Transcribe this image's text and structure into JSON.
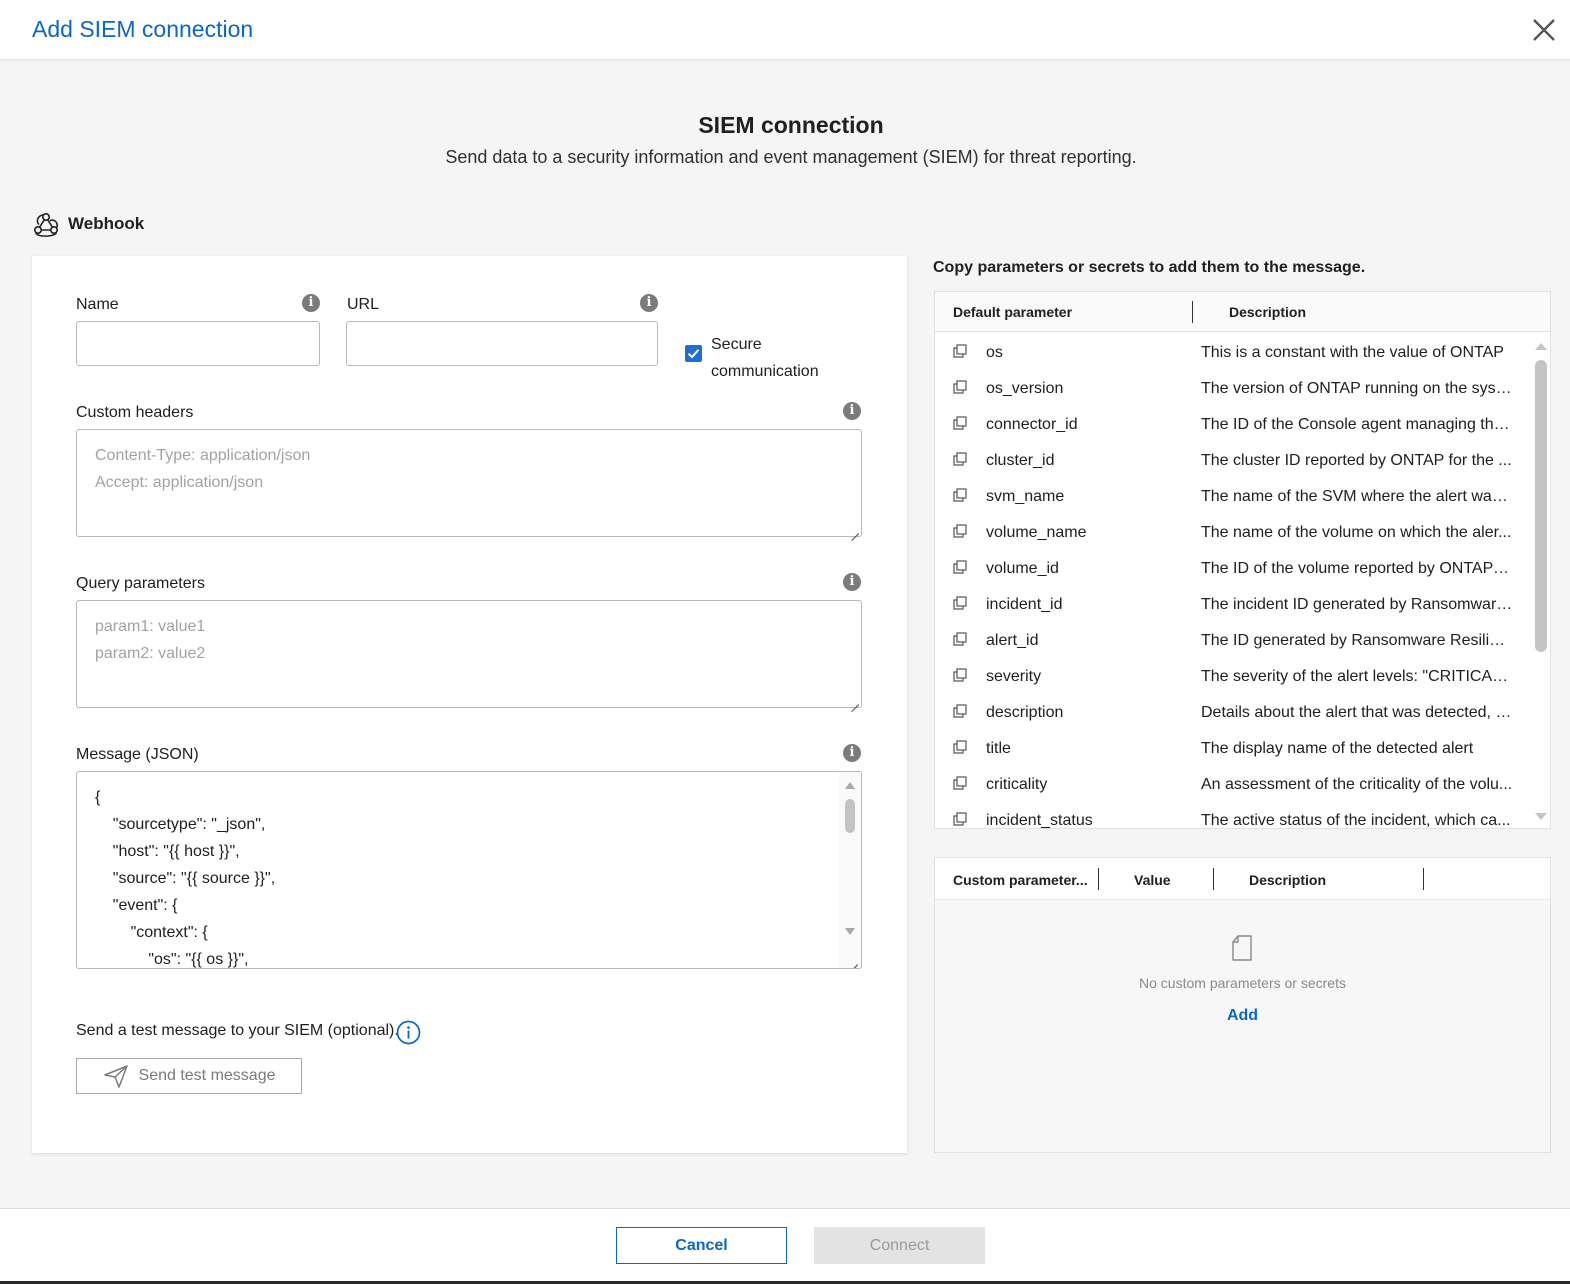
{
  "window": {
    "title": "Add SIEM connection"
  },
  "header": {
    "title": "SIEM connection",
    "subtitle": "Send data to a security information and event management (SIEM) for threat reporting."
  },
  "section": {
    "label": "Webhook",
    "icon": "webhook-icon"
  },
  "form": {
    "name_label": "Name",
    "name_value": "",
    "url_label": "URL",
    "url_value": "",
    "secure_label": "Secure communication",
    "secure_checked": true,
    "custom_headers_label": "Custom headers",
    "custom_headers_placeholder": "Content-Type: application/json\nAccept: application/json",
    "query_params_label": "Query parameters",
    "query_params_placeholder": "param1: value1\nparam2: value2",
    "message_label": "Message (JSON)",
    "message_value": "{\n    \"sourcetype\": \"_json\",\n    \"host\": \"{{ host }}\",\n    \"source\": \"{{ source }}\",\n    \"event\": {\n        \"context\": {\n            \"os\": \"{{ os }}\",",
    "test_text": "Send a test message to your SIEM (optional).",
    "send_test_label": "Send test message"
  },
  "params_panel": {
    "title": "Copy parameters or secrets to add them to the message.",
    "col_param": "Default parameter",
    "col_desc": "Description",
    "rows": [
      {
        "name": "os",
        "desc": "This is a constant with the value of ONTAP"
      },
      {
        "name": "os_version",
        "desc": "The version of ONTAP running on the syst..."
      },
      {
        "name": "connector_id",
        "desc": "The ID of the Console agent managing the..."
      },
      {
        "name": "cluster_id",
        "desc": "The cluster ID reported by ONTAP for the ..."
      },
      {
        "name": "svm_name",
        "desc": "The name of the SVM where the alert was ..."
      },
      {
        "name": "volume_name",
        "desc": "The name of the volume on which the aler..."
      },
      {
        "name": "volume_id",
        "desc": "The ID of the volume reported by ONTAP f..."
      },
      {
        "name": "incident_id",
        "desc": "The incident ID generated by Ransomware..."
      },
      {
        "name": "alert_id",
        "desc": "The ID generated by Ransomware Resilien..."
      },
      {
        "name": "severity",
        "desc": "The severity of the alert levels: \"CRITICAL\",..."
      },
      {
        "name": "description",
        "desc": "Details about the alert that was detected, f..."
      },
      {
        "name": "title",
        "desc": "The display name of the detected alert"
      },
      {
        "name": "criticality",
        "desc": "An assessment of the criticality of the volu..."
      },
      {
        "name": "incident_status",
        "desc": "The active status of the incident, which ca..."
      }
    ]
  },
  "custom_panel": {
    "col_param": "Custom parameter...",
    "col_value": "Value",
    "col_desc": "Description",
    "empty_text": "No custom parameters or secrets",
    "add_label": "Add"
  },
  "footer": {
    "cancel_label": "Cancel",
    "connect_label": "Connect"
  },
  "colors": {
    "accent": "#0b67c0",
    "checkbox": "#1d6fd1"
  }
}
